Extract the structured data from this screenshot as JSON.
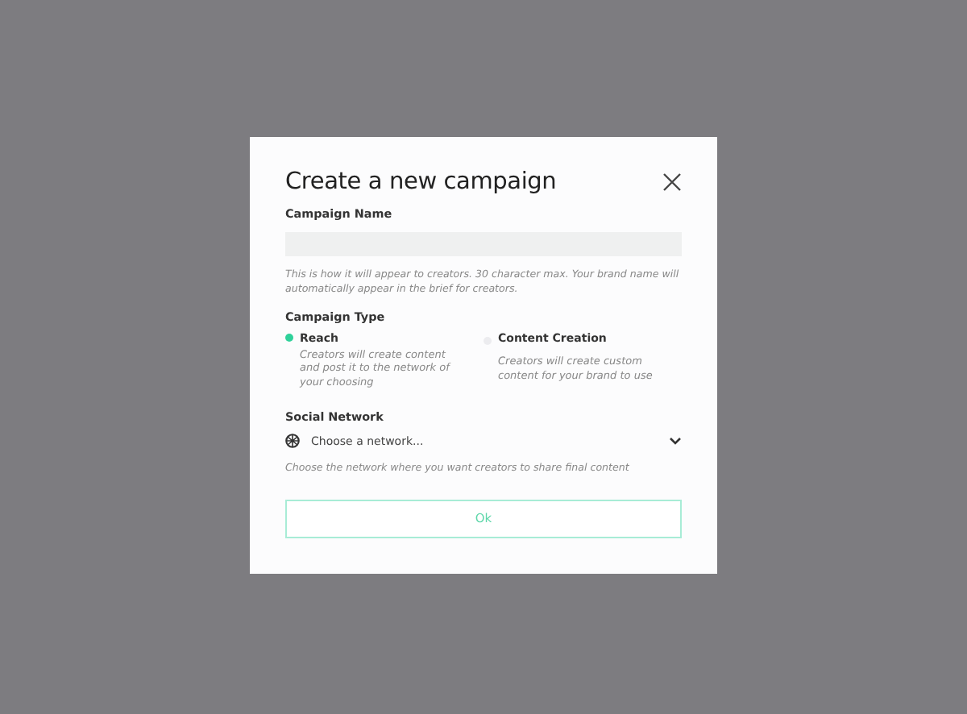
{
  "dialog": {
    "title": "Create a new campaign",
    "campaign_name": {
      "label": "Campaign Name",
      "hint": "This is how it will appear to creators. 30 character max. Your brand name will automatically appear in the brief for creators."
    },
    "campaign_type": {
      "label": "Campaign Type",
      "options": [
        {
          "label": "Reach",
          "description": "Creators will create content and post it to the network of your choosing",
          "selected": true
        },
        {
          "label": "Content Creation",
          "description": "Creators will create custom content for your brand to use",
          "selected": false
        }
      ]
    },
    "social_network": {
      "label": "Social Network",
      "placeholder": "Choose a network...",
      "hint": "Choose the network where you want creators to share final content"
    },
    "ok_button": "Ok"
  }
}
